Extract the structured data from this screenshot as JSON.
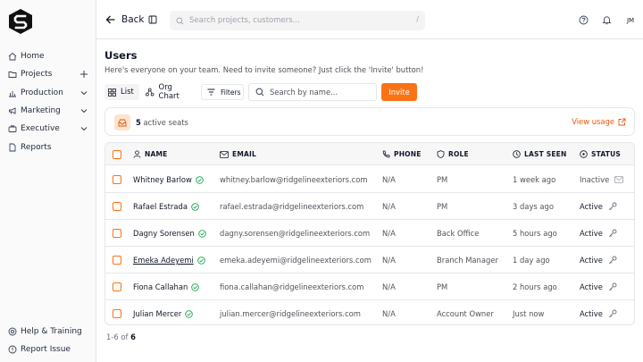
{
  "sidebar": {
    "items": [
      {
        "label": "Home",
        "icon": "home-icon"
      },
      {
        "label": "Projects",
        "icon": "folder-icon",
        "trail": "plus-icon"
      },
      {
        "label": "Production",
        "icon": "chart-icon",
        "trail": "chevron-down-icon"
      },
      {
        "label": "Marketing",
        "icon": "megaphone-icon",
        "trail": "chevron-down-icon"
      },
      {
        "label": "Executive",
        "icon": "briefcase-icon",
        "trail": "chevron-down-icon"
      },
      {
        "label": "Reports",
        "icon": "file-icon"
      }
    ],
    "bottom": [
      {
        "label": "Help & Training",
        "icon": "lifebuoy-icon"
      },
      {
        "label": "Report Issue",
        "icon": "alert-icon"
      }
    ]
  },
  "topbar": {
    "back_label": "Back",
    "search_placeholder": "Search projects, customers...",
    "search_shortcut": "/",
    "avatar_initials": "JM"
  },
  "page": {
    "title": "Users",
    "subtitle": "Here's everyone on your team. Need to invite someone? Just click the 'Invite' button!"
  },
  "toolbar": {
    "list_label": "List",
    "org_chart_label": "Org Chart",
    "filters_label": "Filters",
    "search_placeholder": "Search by name...",
    "invite_label": "Invite"
  },
  "seats": {
    "count": "5",
    "label": "active seats",
    "view_usage": "View usage"
  },
  "table": {
    "headers": {
      "name": "NAME",
      "email": "EMAIL",
      "phone": "PHONE",
      "role": "ROLE",
      "last_seen": "LAST SEEN",
      "status": "STATUS"
    },
    "rows": [
      {
        "name": "Whitney Barlow",
        "email": "whitney.barlow@ridgelineexteriors.com",
        "phone": "N/A",
        "role": "PM",
        "last_seen": "1 week ago",
        "status": "Inactive",
        "status_icon": "mail-icon"
      },
      {
        "name": "Rafael Estrada",
        "email": "rafael.estrada@ridgelineexteriors.com",
        "phone": "N/A",
        "role": "PM",
        "last_seen": "3 days ago",
        "status": "Active",
        "status_icon": "key-icon"
      },
      {
        "name": "Dagny Sorensen",
        "email": "dagny.sorensen@ridgelineexteriors.com",
        "phone": "N/A",
        "role": "Back Office",
        "last_seen": "5 hours ago",
        "status": "Active",
        "status_icon": "key-icon"
      },
      {
        "name": "Emeka Adeyemi",
        "email": "emeka.adeyemi@ridgelineexteriors.com",
        "phone": "N/A",
        "role": "Branch Manager",
        "last_seen": "1 day ago",
        "status": "Active",
        "status_icon": "key-icon"
      },
      {
        "name": "Fiona Callahan",
        "email": "fiona.callahan@ridgelineexteriors.com",
        "phone": "N/A",
        "role": "PM",
        "last_seen": "2 hours ago",
        "status": "Active",
        "status_icon": "key-icon"
      },
      {
        "name": "Julian Mercer",
        "email": "julian.mercer@ridgelineexteriors.com",
        "phone": "N/A",
        "role": "Account Owner",
        "last_seen": "Just now",
        "status": "Active",
        "status_icon": "key-icon"
      }
    ]
  },
  "pager": {
    "range": "1-6",
    "of": "of",
    "total": "6"
  },
  "colors": {
    "accent": "#f97316",
    "verified": "#16a34a"
  }
}
